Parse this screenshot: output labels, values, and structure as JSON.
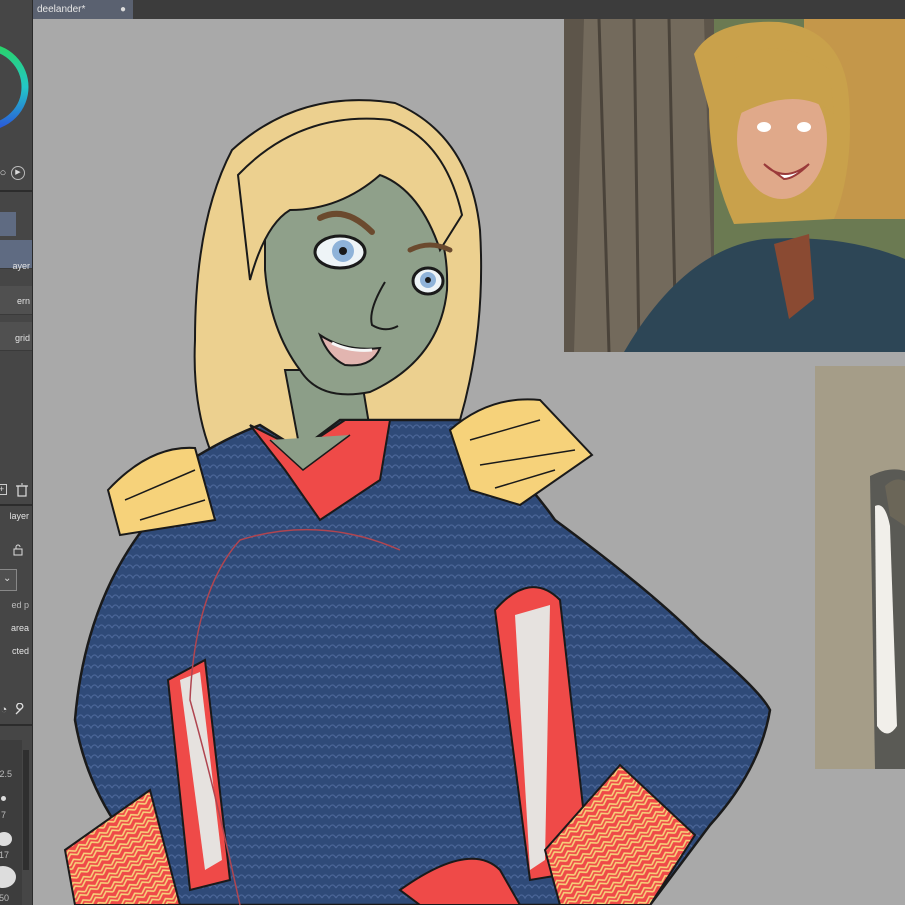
{
  "document": {
    "tab_title": "deelander*",
    "tab_close": "●"
  },
  "sidebar": {
    "layer_labels": [
      "ayer",
      "ern",
      "grid"
    ],
    "section_label": "layer",
    "property_labels": [
      "ed p",
      "area",
      "cted"
    ],
    "brush_sizes": [
      "2.5",
      "7",
      "17",
      "50"
    ]
  },
  "icons": {
    "new_layer": "new-layer-icon",
    "delete_layer": "trash-icon",
    "lock": "lock-icon",
    "play": "play-icon",
    "wrench": "wrench-icon"
  },
  "colors": {
    "canvas_bg": "#a9a9a9",
    "suit_blue": "#2f4a78",
    "suit_red": "#ef4a48",
    "epaulette_gold": "#f6d27a",
    "hair_blonde": "#ecd08f",
    "skin_green": "#8fa08a"
  }
}
